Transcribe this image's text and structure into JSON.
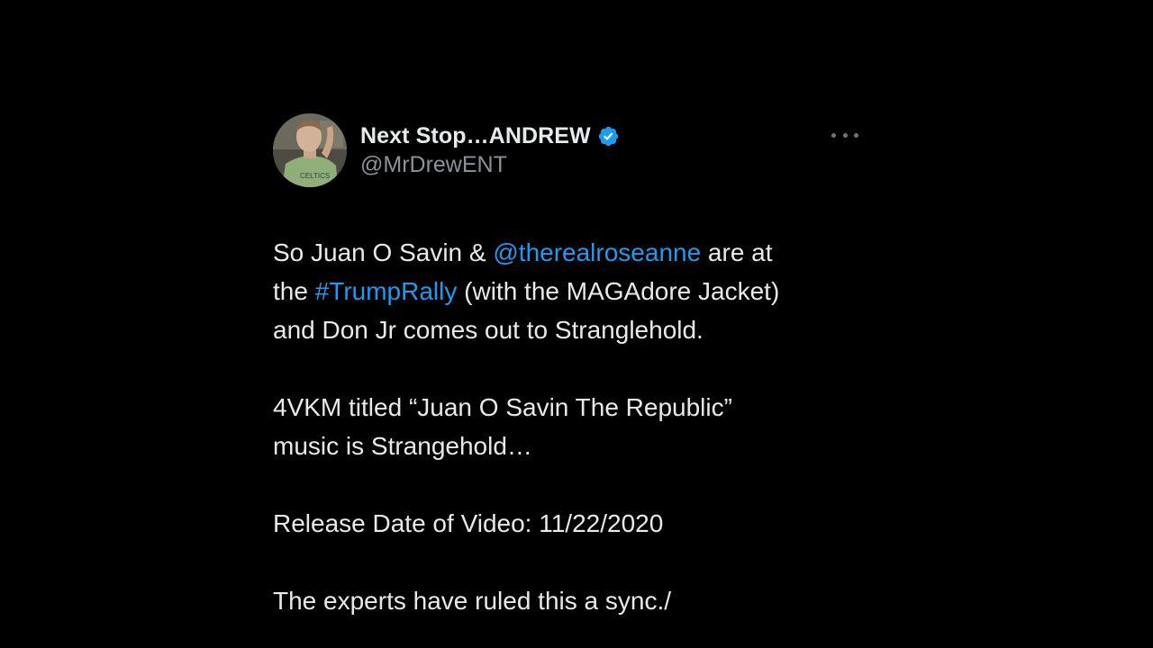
{
  "tweet": {
    "display_name": "Next Stop…ANDREW",
    "handle": "@MrDrewENT",
    "verified": true,
    "more_icon": "more-horizontal-icon",
    "avatar_shirt_text": "CELTICS",
    "colors": {
      "background": "#000000",
      "text": "#e7e9ea",
      "secondary": "#8b9299",
      "link": "#1d9bf0"
    },
    "body": {
      "p1_a": "So Juan O Savin & ",
      "p1_mention": "@therealroseanne",
      "p1_b": " are at",
      "p1_c": "the ",
      "p1_hashtag": "#TrumpRally",
      "p1_d": " (with the MAGAdore Jacket)",
      "p1_e": "and Don Jr comes out to Stranglehold.",
      "p2_a": "4VKM titled “Juan O Savin The Republic”",
      "p2_b": "music is Strangehold…",
      "p3": "Release Date of Video: 11/22/2020",
      "p4": "The experts have ruled this a sync./"
    }
  }
}
